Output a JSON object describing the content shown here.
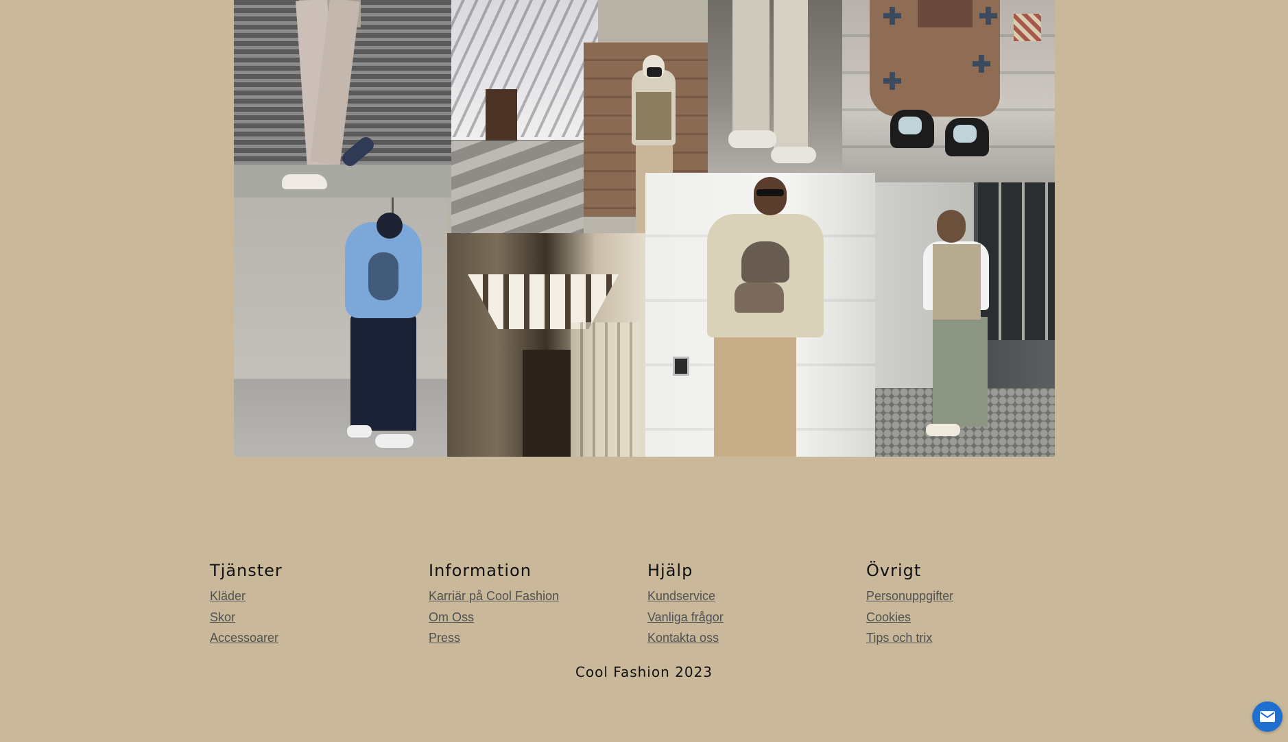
{
  "collage": {
    "images": [
      "man-in-beige-trousers",
      "white-building-slatted-roof",
      "man-in-cap-and-vest",
      "beige-cargo-pants",
      "brown-jeans-sneakers",
      "blue-hoodie-back",
      "lit-corridor",
      "woman-oversized-tee",
      "man-utility-vest"
    ]
  },
  "footer": {
    "columns": [
      {
        "heading": "Tjänster",
        "links": [
          "Kläder",
          "Skor",
          "Accessoarer"
        ]
      },
      {
        "heading": "Information",
        "links": [
          "Karriär på Cool Fashion",
          "Om Oss",
          "Press"
        ]
      },
      {
        "heading": "Hjälp",
        "links": [
          "Kundservice",
          "Vanliga frågor",
          "Kontakta oss"
        ]
      },
      {
        "heading": "Övrigt",
        "links": [
          "Personuppgifter",
          "Cookies",
          "Tips och trix"
        ]
      }
    ],
    "copyright": "Cool Fashion 2023"
  },
  "contact_button": {
    "icon": "mail-icon"
  },
  "colors": {
    "background": "#c9b99a",
    "link": "#505050",
    "accent": "#1f6fd1"
  }
}
